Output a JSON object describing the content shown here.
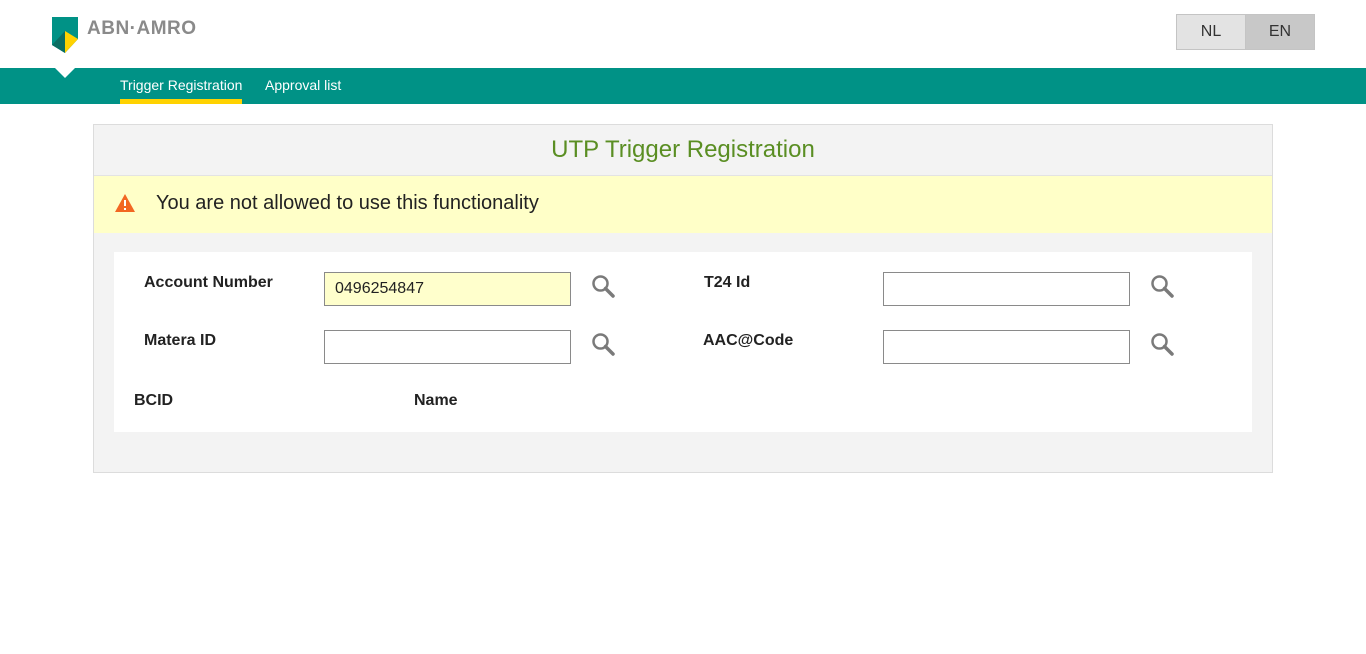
{
  "brand": {
    "name": "ABN·AMRO",
    "logo_colors": {
      "green": "#009286",
      "yellow": "#ffd200"
    }
  },
  "language": {
    "options": [
      "NL",
      "EN"
    ],
    "selected": "EN"
  },
  "nav": {
    "tabs": [
      {
        "label": "Trigger Registration",
        "active": true
      },
      {
        "label": "Approval list",
        "active": false
      }
    ]
  },
  "panel": {
    "title": "UTP Trigger Registration"
  },
  "alert": {
    "message": "You are not allowed to use this functionality",
    "icon": "warning-icon",
    "color": "#f26722"
  },
  "form": {
    "account_number": {
      "label": "Account Number",
      "value": "0496254847"
    },
    "t24_id": {
      "label": "T24 Id",
      "value": ""
    },
    "matera_id": {
      "label": "Matera ID",
      "value": ""
    },
    "aac_code": {
      "label": "AAC@Code",
      "value": ""
    },
    "bcid_label": "BCID",
    "name_label": "Name"
  },
  "colors": {
    "nav_bg": "#009286",
    "active_tab_underline": "#ffd200",
    "title_green": "#5a8e23",
    "alert_bg": "#ffffc8"
  }
}
